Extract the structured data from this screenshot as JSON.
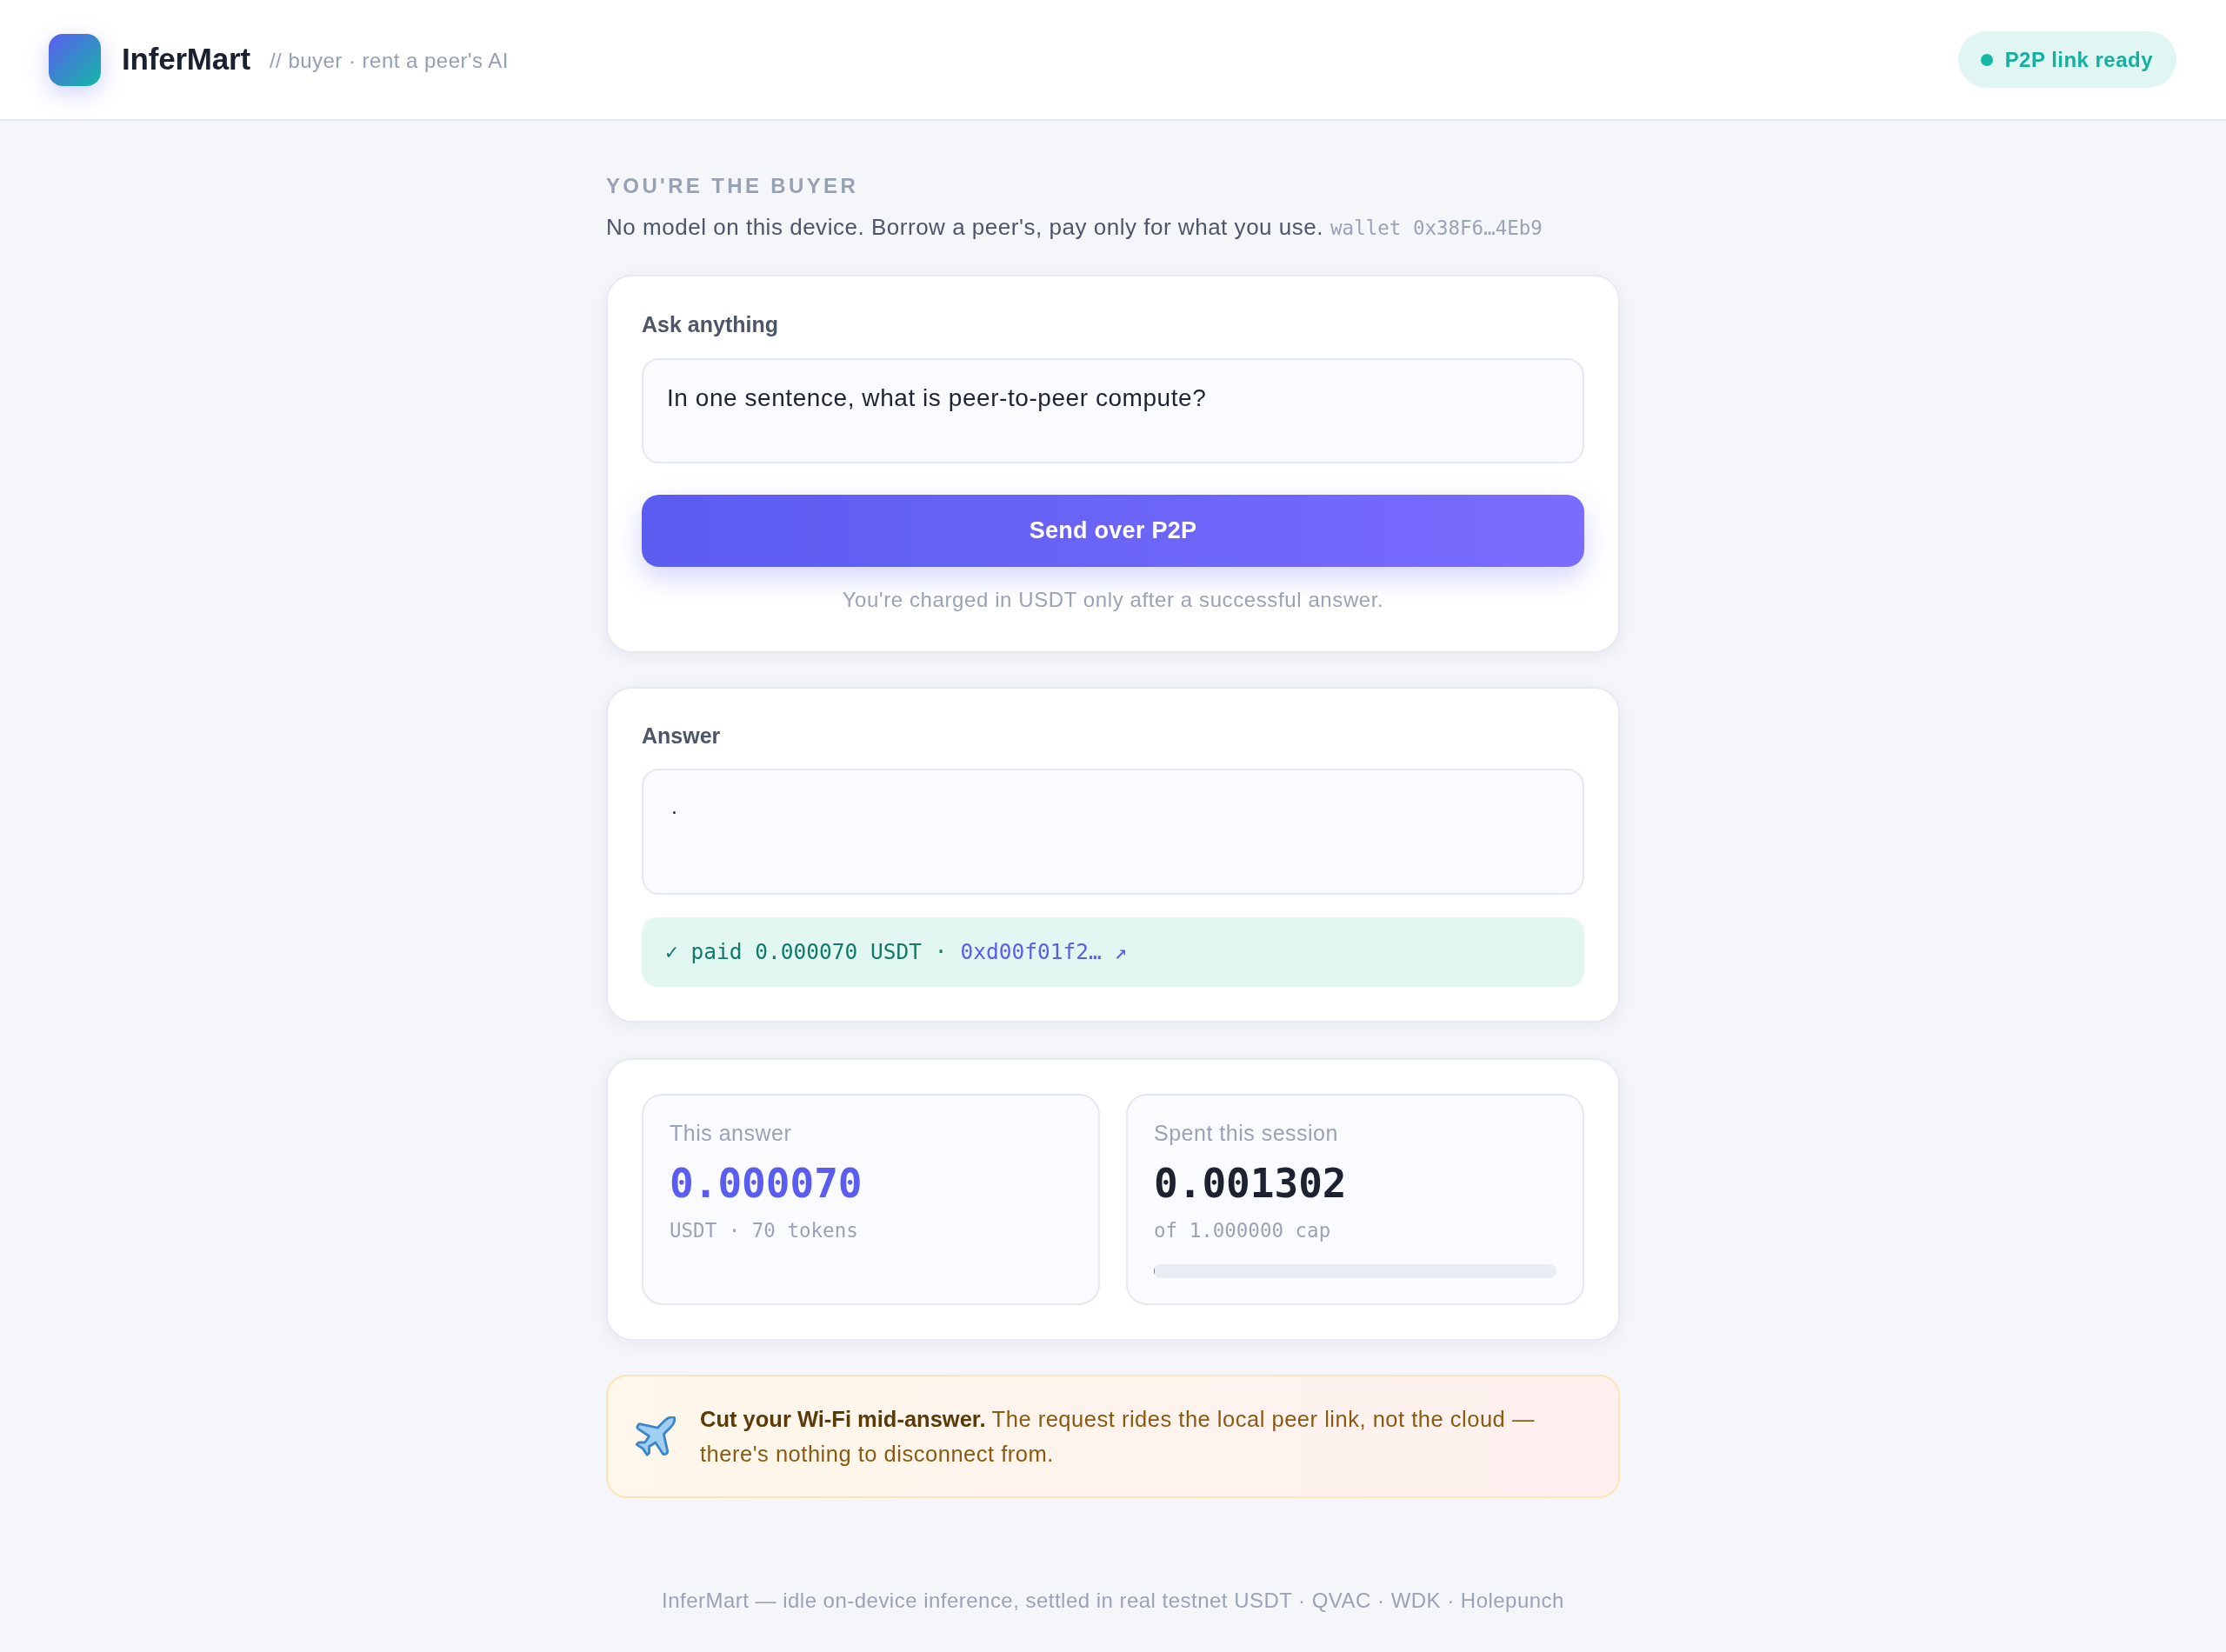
{
  "header": {
    "brand": "InferMart",
    "tagline": "// buyer · rent a peer's AI",
    "status": {
      "label": "P2P link ready",
      "on": true
    }
  },
  "intro": {
    "eyebrow": "YOU'RE THE BUYER",
    "description": "No model on this device. Borrow a peer's, pay only for what you use.",
    "wallet": "wallet 0x38F6…4Eb9"
  },
  "ask_card": {
    "label": "Ask anything",
    "prompt": {
      "value": "In one sentence, what is peer-to-peer compute?"
    },
    "button": "Send over P2P",
    "note": "You're charged in USDT only after a successful answer."
  },
  "answer_card": {
    "label": "Answer",
    "answer": {
      "value": "."
    },
    "receipt": {
      "text": "✓ paid 0.000070 USDT ·",
      "link": "0xd00f01f2… ↗"
    }
  },
  "stats": [
    {
      "kind": "accent",
      "label": "This answer",
      "value": "0.000070",
      "detail": "USDT · 70 tokens"
    },
    {
      "kind": "meter",
      "label": "Spent this session",
      "value": "0.001302",
      "detail": "of 1.000000 cap",
      "level": 0.0013
    }
  ],
  "tip": {
    "text": "**Cut your Wi-Fi mid-answer.** The request rides the local peer link, not the cloud — there's nothing to disconnect from."
  },
  "footer": {
    "text": "InferMart — idle on-device inference, settled in real testnet USDT · QVAC · WDK · Holepunch"
  }
}
